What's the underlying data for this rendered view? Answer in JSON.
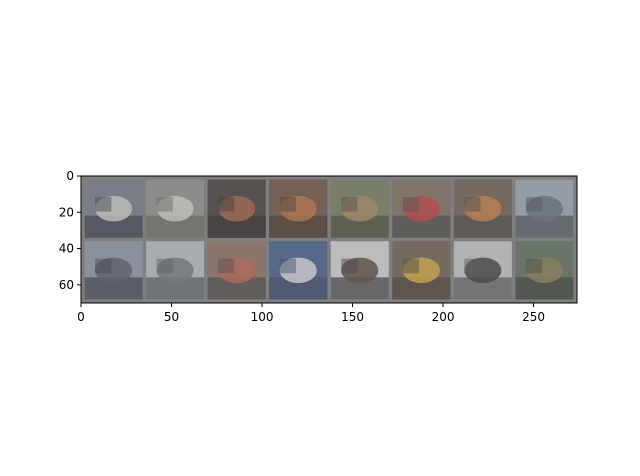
{
  "figure": {
    "type": "image-grid",
    "x_ticks": [
      "0",
      "50",
      "100",
      "150",
      "200",
      "250"
    ],
    "y_ticks": [
      "0",
      "20",
      "40",
      "60"
    ],
    "x_range": [
      0,
      274
    ],
    "y_range": [
      0,
      70
    ],
    "grid": {
      "rows": 2,
      "cols": 8
    },
    "background_color": "#7f7f7f",
    "tiles": [
      {
        "icon": "truck-tile",
        "base": "#6f7788",
        "accent": "#d8d6d2",
        "dark": "#2a2e3a"
      },
      {
        "icon": "truck-tile",
        "base": "#8e908a",
        "accent": "#d9d9d3",
        "dark": "#5a5e58"
      },
      {
        "icon": "frog-tile",
        "base": "#3d3330",
        "accent": "#a85a3a",
        "dark": "#1f1a18"
      },
      {
        "icon": "horse-tile",
        "base": "#6a4a3a",
        "accent": "#c06a38",
        "dark": "#3a2820"
      },
      {
        "icon": "deer-tile",
        "base": "#6d7a5a",
        "accent": "#a8875a",
        "dark": "#3f3a2e"
      },
      {
        "icon": "truck-tile",
        "base": "#7a6a5a",
        "accent": "#c83030",
        "dark": "#3a3a3a"
      },
      {
        "icon": "dog-tile",
        "base": "#6a5a4a",
        "accent": "#d07a3a",
        "dark": "#3a3a38"
      },
      {
        "icon": "ship-tile",
        "base": "#9aa7b4",
        "accent": "#5a6670",
        "dark": "#3a4048"
      },
      {
        "icon": "ship-tile",
        "base": "#8d96a6",
        "accent": "#4a4f58",
        "dark": "#2a2e36"
      },
      {
        "icon": "ship-tile",
        "base": "#b8bfc4",
        "accent": "#6a6e72",
        "dark": "#4a4c50"
      },
      {
        "icon": "automobile-tile",
        "base": "#8a6a5a",
        "accent": "#c05a48",
        "dark": "#3a3a3a"
      },
      {
        "icon": "ship-tile",
        "base": "#3a5a8a",
        "accent": "#e8e8e8",
        "dark": "#2a3a5a"
      },
      {
        "icon": "horse-tile",
        "base": "#d8d8d8",
        "accent": "#4a3a2a",
        "dark": "#2a2a2a"
      },
      {
        "icon": "automobile-tile",
        "base": "#6a5a4a",
        "accent": "#e0b030",
        "dark": "#3a3028"
      },
      {
        "icon": "ship-tile",
        "base": "#c8c8c8",
        "accent": "#2a2a2a",
        "dark": "#4a4a4a"
      },
      {
        "icon": "deer-tile",
        "base": "#5a6a5a",
        "accent": "#8a7a4a",
        "dark": "#2a2e2a"
      }
    ]
  }
}
